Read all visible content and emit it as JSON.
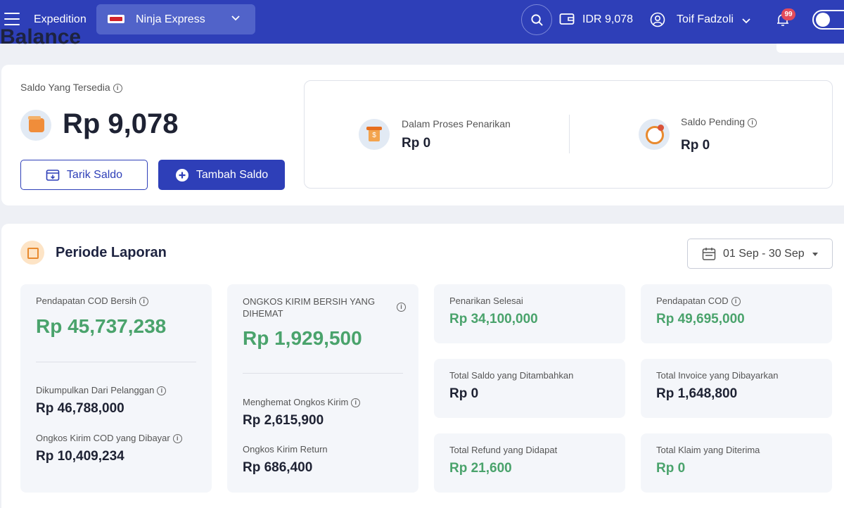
{
  "header": {
    "app_title": "Expedition",
    "courier": "Ninja Express",
    "balance": "IDR 9,078",
    "user_name": "Toif Fadzoli",
    "notification_count": "99"
  },
  "page": {
    "heading": "Balance"
  },
  "balance_card": {
    "available_label": "Saldo Yang Tersedia",
    "available_amount": "Rp 9,078",
    "withdraw_button": "Tarik Saldo",
    "topup_button": "Tambah Saldo",
    "in_process_label": "Dalam Proses Penarikan",
    "in_process_value": "Rp 0",
    "pending_label": "Saldo Pending",
    "pending_value": "Rp 0"
  },
  "report": {
    "title": "Periode Laporan",
    "date_range": "01 Sep - 30 Sep",
    "cod_net": {
      "label": "Pendapatan COD Bersih",
      "value": "Rp 45,737,238"
    },
    "collected": {
      "label": "Dikumpulkan Dari Pelanggan",
      "value": "Rp 46,788,000"
    },
    "cod_shipping_paid": {
      "label": "Ongkos Kirim COD yang Dibayar",
      "value": "Rp 10,409,234"
    },
    "shipping_saved": {
      "label": "ONGKOS KIRIM BERSIH YANG DIHEMAT",
      "value": "Rp 1,929,500"
    },
    "shipping_saving": {
      "label": "Menghemat Ongkos Kirim",
      "value": "Rp 2,615,900"
    },
    "return_shipping": {
      "label": "Ongkos Kirim Return",
      "value": "Rp 686,400"
    },
    "withdrawn": {
      "label": "Penarikan Selesai",
      "value": "Rp 34,100,000"
    },
    "balance_added": {
      "label": "Total Saldo yang Ditambahkan",
      "value": "Rp 0"
    },
    "refund": {
      "label": "Total Refund yang Didapat",
      "value": "Rp 21,600"
    },
    "cod_income": {
      "label": "Pendapatan COD",
      "value": "Rp 49,695,000"
    },
    "invoice_paid": {
      "label": "Total Invoice yang Dibayarkan",
      "value": "Rp 1,648,800"
    },
    "claims": {
      "label": "Total Klaim yang Diterima",
      "value": "Rp 0"
    }
  },
  "colors": {
    "primary": "#2e3fb8",
    "positive": "#4aa36c"
  }
}
